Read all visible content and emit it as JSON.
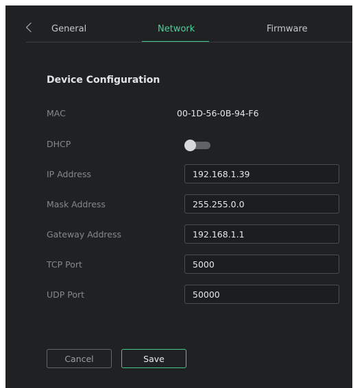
{
  "tabs": {
    "back_icon": "chevron-left-icon",
    "items": [
      {
        "label": "General",
        "active": false
      },
      {
        "label": "Network",
        "active": true
      },
      {
        "label": "Firmware",
        "active": false
      }
    ]
  },
  "section": {
    "title": "Device Configuration"
  },
  "fields": {
    "mac": {
      "label": "MAC",
      "value": "00-1D-56-0B-94-F6"
    },
    "dhcp": {
      "label": "DHCP",
      "enabled": false
    },
    "ip": {
      "label": "IP Address",
      "value": "192.168.1.39"
    },
    "mask": {
      "label": "Mask Address",
      "value": "255.255.0.0"
    },
    "gateway": {
      "label": "Gateway Address",
      "value": "192.168.1.1"
    },
    "tcp": {
      "label": "TCP Port",
      "value": "5000"
    },
    "udp": {
      "label": "UDP Port",
      "value": "50000"
    }
  },
  "actions": {
    "cancel_label": "Cancel",
    "save_label": "Save"
  },
  "colors": {
    "panel_bg": "#202122",
    "accent": "#4fd19b",
    "label_text": "#85888c",
    "input_border": "#4a4d51"
  }
}
